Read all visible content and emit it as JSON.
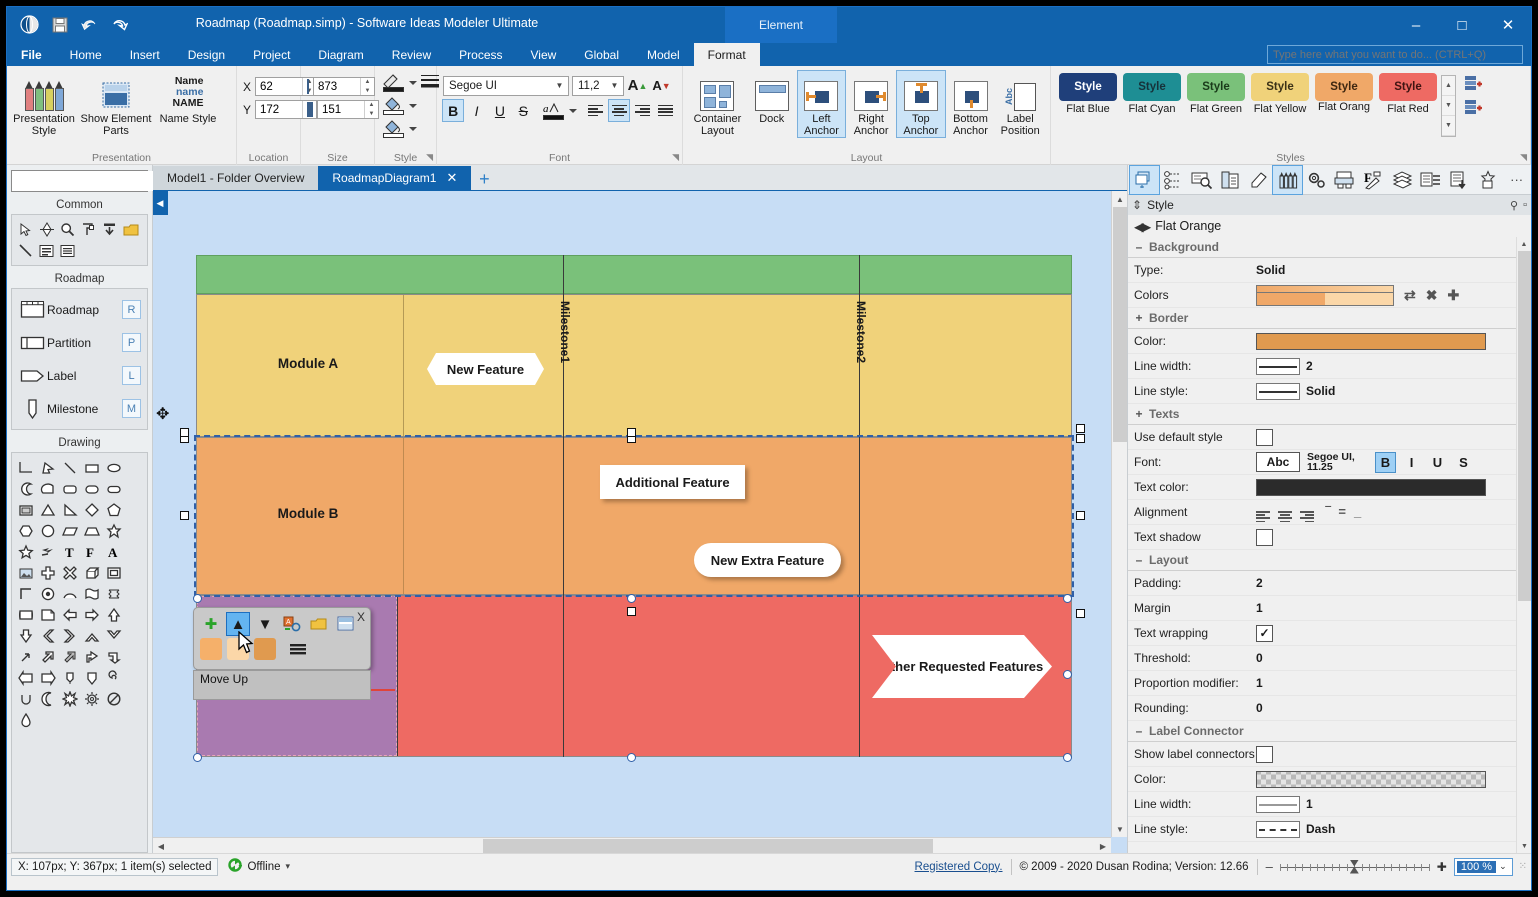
{
  "window": {
    "title": "Roadmap (Roadmap.simp)  - Software Ideas Modeler Ultimate",
    "context_tab": "Element",
    "minimize": "–",
    "maximize": "□",
    "close": "✕"
  },
  "quick_access": [
    {
      "name": "app-logo-icon",
      "glyph": "◐"
    },
    {
      "name": "save-icon",
      "glyph": "▤"
    },
    {
      "name": "undo-icon",
      "glyph": "↶"
    },
    {
      "name": "redo-icon",
      "glyph": "↷"
    }
  ],
  "ribbon_tabs": [
    {
      "label": "File",
      "active": false
    },
    {
      "label": "Home",
      "active": false
    },
    {
      "label": "Insert",
      "active": false
    },
    {
      "label": "Design",
      "active": false
    },
    {
      "label": "Project",
      "active": false
    },
    {
      "label": "Diagram",
      "active": false
    },
    {
      "label": "Review",
      "active": false
    },
    {
      "label": "Process",
      "active": false
    },
    {
      "label": "View",
      "active": false
    },
    {
      "label": "Global",
      "active": false
    },
    {
      "label": "Model",
      "active": false
    },
    {
      "label": "Format",
      "active": true
    }
  ],
  "search": {
    "placeholder": "Type here what you want to do... (CTRL+Q)",
    "value": ""
  },
  "ribbon": {
    "presentation": {
      "group_label": "Presentation",
      "presentation_style": "Presentation Style",
      "show_element_parts": "Show Element Parts",
      "name_style": "Name Style",
      "name_style_preview": [
        "Name",
        "name",
        "NAME"
      ]
    },
    "location": {
      "group_label": "Location",
      "x_label": "X",
      "x_value": "62",
      "y_label": "Y",
      "y_value": "172"
    },
    "size": {
      "group_label": "Size",
      "width_value": "873",
      "height_value": "151"
    },
    "style": {
      "group_label": "Style",
      "line_color": "line-color-picker",
      "line_width": "line-width-picker",
      "fill_color": "fill-color-picker",
      "fill_color2": "secondary-fill-color-picker"
    },
    "font": {
      "group_label": "Font",
      "family": "Segoe UI",
      "size": "11,2",
      "grow": "A",
      "shrink": "A",
      "bold": "B",
      "italic": "I",
      "underline": "U",
      "strike": "S",
      "bold_on": true
    },
    "layout": {
      "group_label": "Layout",
      "container_layout": "Container Layout",
      "dock": "Dock",
      "left_anchor": "Left Anchor",
      "right_anchor": "Right Anchor",
      "top_anchor": "Top Anchor",
      "bottom_anchor": "Bottom Anchor",
      "label_position": "Label Position",
      "label_position_icon_text": "Abc",
      "left_anchor_on": true,
      "top_anchor_on": true
    },
    "styles": {
      "group_label": "Styles",
      "items": [
        {
          "name": "Flat Blue",
          "label": "Style",
          "bg": "#1f3f7a",
          "fg": "#ffffff"
        },
        {
          "name": "Flat Cyan",
          "label": "Style",
          "bg": "#1e8e94",
          "fg": "#16323a"
        },
        {
          "name": "Flat Green",
          "label": "Style",
          "bg": "#7ac17a",
          "fg": "#1a3b1a"
        },
        {
          "name": "Flat Yellow",
          "label": "Style",
          "bg": "#f0d27a",
          "fg": "#3b3117"
        },
        {
          "name": "Flat Orang",
          "label": "Style",
          "bg": "#f0a868",
          "fg": "#3f2710"
        },
        {
          "name": "Flat Red",
          "label": "Style",
          "bg": "#ee6a63",
          "fg": "#3f1412"
        }
      ]
    }
  },
  "toolbox": {
    "search_placeholder": "",
    "sections": [
      {
        "title": "Common"
      },
      {
        "title": "Roadmap"
      },
      {
        "title": "Drawing"
      }
    ],
    "common_icons": [
      {
        "name": "select-pointer-icon",
        "glyph": "➤"
      },
      {
        "name": "connector-icon",
        "glyph": "◈"
      },
      {
        "name": "zoom-icon",
        "glyph": "🔍"
      },
      {
        "name": "format-painter-icon",
        "glyph": "⌐"
      },
      {
        "name": "insert-icon",
        "glyph": "⤓"
      },
      {
        "name": "note-icon",
        "glyph": "▰"
      },
      {
        "name": "line-icon",
        "glyph": "╲"
      },
      {
        "name": "text-block-icon",
        "glyph": "▤"
      },
      {
        "name": "text-area-icon",
        "glyph": "▤"
      }
    ],
    "roadmap_items": [
      {
        "label": "Roadmap",
        "key": "R",
        "icon": "roadmap-icon"
      },
      {
        "label": "Partition",
        "key": "P",
        "icon": "partition-icon"
      },
      {
        "label": "Label",
        "key": "L",
        "icon": "label-icon"
      },
      {
        "label": "Milestone",
        "key": "M",
        "icon": "milestone-icon"
      }
    ],
    "drawing_shapes": [
      "elbow",
      "arrow-cursor",
      "diagonal-line",
      "rectangle",
      "ellipse",
      "crescent",
      "half-ellipse",
      "rounded-rect",
      "stadium",
      "pill",
      "framed-rect",
      "triangle",
      "right-triangle",
      "diamond",
      "pentagon",
      "hexagon",
      "circle",
      "parallelogram",
      "trapezoid",
      "flag-star",
      "star",
      "lightning",
      "text-t",
      "text-f",
      "text-a",
      "image",
      "cross",
      "x-cross",
      "cube",
      "double-square",
      "corner",
      "target",
      "arc",
      "banner",
      "torn-edge",
      "scroll",
      "folded-corner",
      "arrow-left",
      "arrow-right",
      "arrow-up",
      "arrow-down",
      "chevron-left",
      "chevron-right",
      "chevron-up",
      "chevron-down",
      "arrow-ne",
      "arrow-ne-block",
      "arrow-ne-3d",
      "bent-arrow",
      "bent-arrow-2",
      "callout-left",
      "callout-right",
      "pennant",
      "pin",
      "spiral",
      "spiral-2",
      "moon",
      "burst",
      "gear",
      "no-entry",
      "droplet"
    ]
  },
  "diagram_tabs": [
    {
      "label": "Model1 - Folder Overview",
      "active": false,
      "closable": false
    },
    {
      "label": "RoadmapDiagram1",
      "active": true,
      "closable": true
    }
  ],
  "tab_add": "+",
  "diagram": {
    "header_band": {
      "color": "#7ac17a"
    },
    "rows": [
      {
        "name": "Module A",
        "color": "#f0d27a",
        "border": "#9a8a4e"
      },
      {
        "name": "Module B",
        "color": "#f0a868",
        "border": "#a8713a"
      },
      {
        "name": "",
        "color": "#ee6a63",
        "border": "#a8423c"
      }
    ],
    "milestones": [
      "Milestone1",
      "Milestone2"
    ],
    "labels": [
      {
        "text": "New Feature",
        "shape": "hex"
      },
      {
        "text": "Additional Feature",
        "shape": "rect"
      },
      {
        "text": "New Extra Feature",
        "shape": "round"
      },
      {
        "text": "Other Requested Features",
        "shape": "arrow"
      }
    ],
    "drop_highlight_color": "#a97ab0"
  },
  "float_toolbar": {
    "tooltip": "Move Up",
    "close": "X",
    "buttons": [
      {
        "name": "add-button",
        "glyph": "✚",
        "selected": false
      },
      {
        "name": "move-up-button",
        "glyph": "▲",
        "selected": true
      },
      {
        "name": "move-down-button",
        "glyph": "▼",
        "selected": false
      },
      {
        "name": "replace-element-button",
        "glyph": "▣",
        "selected": false
      },
      {
        "name": "note-button",
        "glyph": "▰",
        "selected": false
      },
      {
        "name": "layout-button",
        "glyph": "▤",
        "selected": false
      }
    ],
    "swatches": [
      "#f5b06a",
      "#fbd7a8",
      "#e09a4f"
    ],
    "lines_button": {
      "name": "lines-button",
      "glyph": "≡"
    }
  },
  "right_panel": {
    "toolbar_icons": [
      {
        "name": "diagrams-icon",
        "selected": false
      },
      {
        "name": "model-tree-icon",
        "selected": false
      },
      {
        "name": "search-model-icon",
        "selected": false
      },
      {
        "name": "documentation-icon",
        "selected": false
      },
      {
        "name": "properties-icon",
        "selected": false
      },
      {
        "name": "style-icon",
        "selected": true
      },
      {
        "name": "settings-icon",
        "selected": false
      },
      {
        "name": "output-icon",
        "selected": false
      },
      {
        "name": "format-icon",
        "selected": false
      },
      {
        "name": "layers-icon",
        "selected": false
      },
      {
        "name": "notes-icon",
        "selected": false
      },
      {
        "name": "validation-icon",
        "selected": false
      },
      {
        "name": "favorites-icon",
        "selected": false
      },
      {
        "name": "more-icon",
        "selected": false
      }
    ],
    "panel_title": "Style",
    "style_name": "Flat Orange",
    "groups": [
      {
        "id": "background",
        "title": "Background",
        "toggle": "–",
        "rows": [
          {
            "key": "Type:",
            "type": "text",
            "value": "Solid"
          },
          {
            "key": "Colors",
            "type": "gradient",
            "colors": [
              "#f0a868",
              "#fbd7a8"
            ],
            "actions": [
              {
                "name": "swap-colors-icon",
                "glyph": "⇄"
              },
              {
                "name": "remove-color-icon",
                "glyph": "✖"
              },
              {
                "name": "add-color-icon",
                "glyph": "✚"
              }
            ]
          }
        ]
      },
      {
        "id": "border",
        "title": "Border",
        "toggle": "+",
        "rows": [
          {
            "key": "Color:",
            "type": "color",
            "value": "#e09a4f"
          },
          {
            "key": "Line width:",
            "type": "line",
            "value": "2",
            "style": "solid",
            "color": "#333333"
          },
          {
            "key": "Line style:",
            "type": "line",
            "value": "Solid",
            "style": "solid",
            "color": "#333333"
          }
        ]
      },
      {
        "id": "texts",
        "title": "Texts",
        "toggle": "+",
        "rows": [
          {
            "key": "Use default style",
            "type": "checkbox",
            "checked": false
          },
          {
            "key": "Font:",
            "type": "font",
            "preview": "Abc",
            "value": "Segoe UI, 11.25",
            "buttons": [
              {
                "label": "B",
                "on": true
              },
              {
                "label": "I",
                "on": false
              },
              {
                "label": "U",
                "on": false
              },
              {
                "label": "S",
                "on": false
              }
            ]
          },
          {
            "key": "Text color:",
            "type": "color",
            "value": "#2b2b2b"
          },
          {
            "key": "Alignment",
            "type": "alignment"
          },
          {
            "key": "Text shadow",
            "type": "checkbox",
            "checked": false
          }
        ]
      },
      {
        "id": "layout",
        "title": "Layout",
        "toggle": "–",
        "rows": [
          {
            "key": "Padding:",
            "type": "text",
            "value": "2"
          },
          {
            "key": "Margin",
            "type": "text",
            "value": "1"
          },
          {
            "key": "Text wrapping",
            "type": "checkbox",
            "checked": true
          },
          {
            "key": "Threshold:",
            "type": "text",
            "value": "0"
          },
          {
            "key": "Proportion modifier:",
            "type": "text",
            "value": "1"
          },
          {
            "key": "Rounding:",
            "type": "text",
            "value": "0"
          }
        ]
      },
      {
        "id": "labelconnector",
        "title": "Label Connector",
        "toggle": "–",
        "rows": [
          {
            "key": "Show label connectors",
            "type": "checkbox",
            "checked": false
          },
          {
            "key": "Color:",
            "type": "transparent"
          },
          {
            "key": "Line width:",
            "type": "line",
            "value": "1",
            "style": "solid",
            "color": "#999999"
          },
          {
            "key": "Line style:",
            "type": "line",
            "value": "Dash",
            "style": "dash",
            "color": "#333333"
          }
        ]
      }
    ]
  },
  "status_bar": {
    "coords": "X: 107px; Y: 367px; 1 item(s) selected",
    "connection_icon": "sync-icon",
    "connection": "Offline",
    "connection_caret": "▾",
    "registered": "Registered Copy.",
    "copyright": "© 2009 - 2020 Dusan Rodina; Version: 12.66",
    "zoom_minus": "–",
    "zoom_plus": "✚",
    "zoom_value": "100 %",
    "zoom_caret": "⌄"
  }
}
